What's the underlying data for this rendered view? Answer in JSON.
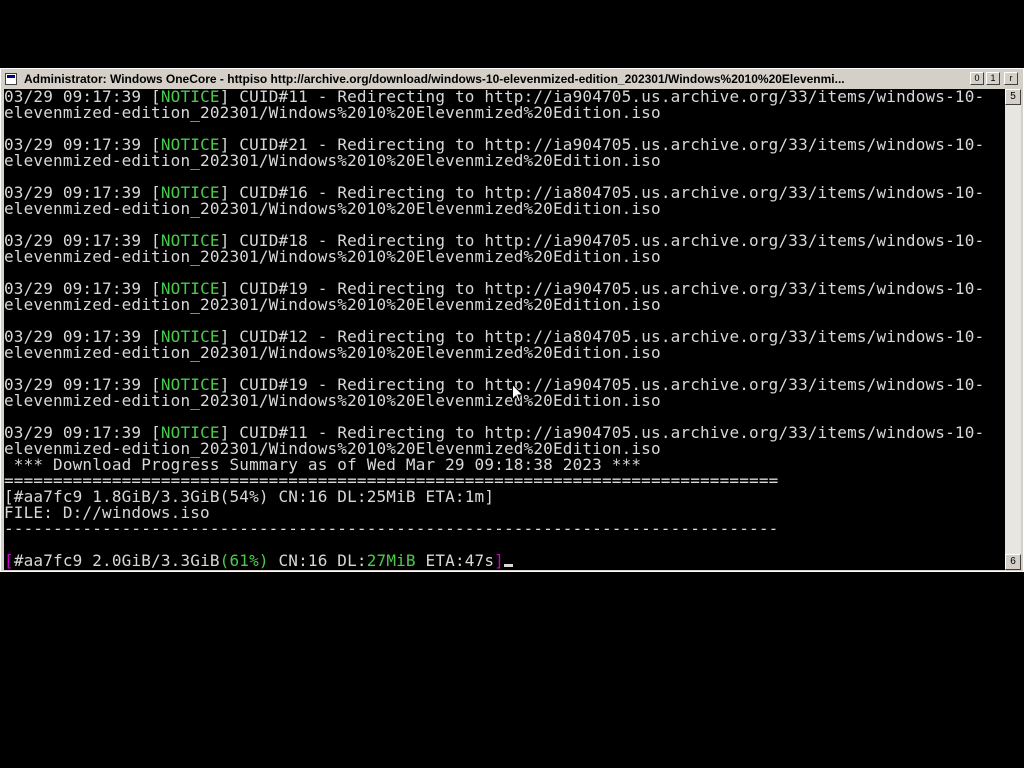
{
  "window": {
    "title": "Administrator:  Windows OneCore - httpiso  http://archive.org/download/windows-10-elevenmized-edition_202301/Windows%2010%20Elevenmi...",
    "minimize_glyph": "0",
    "maximize_glyph": "1",
    "close_glyph": "r"
  },
  "scrollbar": {
    "up_glyph": "5",
    "down_glyph": "6"
  },
  "log_entries": [
    {
      "time": "03/29 09:17:39 ",
      "lb": "[",
      "level": "NOTICE",
      "rb": "]",
      "msg": " CUID#11 - Redirecting to http://ia904705.us.archive.org/33/items/windows-10-",
      "cont": "elevenmized-edition_202301/Windows%2010%20Elevenmized%20Edition.iso"
    },
    {
      "time": "03/29 09:17:39 ",
      "lb": "[",
      "level": "NOTICE",
      "rb": "]",
      "msg": " CUID#21 - Redirecting to http://ia904705.us.archive.org/33/items/windows-10-",
      "cont": "elevenmized-edition_202301/Windows%2010%20Elevenmized%20Edition.iso"
    },
    {
      "time": "03/29 09:17:39 ",
      "lb": "[",
      "level": "NOTICE",
      "rb": "]",
      "msg": " CUID#16 - Redirecting to http://ia804705.us.archive.org/33/items/windows-10-",
      "cont": "elevenmized-edition_202301/Windows%2010%20Elevenmized%20Edition.iso"
    },
    {
      "time": "03/29 09:17:39 ",
      "lb": "[",
      "level": "NOTICE",
      "rb": "]",
      "msg": " CUID#18 - Redirecting to http://ia904705.us.archive.org/33/items/windows-10-",
      "cont": "elevenmized-edition_202301/Windows%2010%20Elevenmized%20Edition.iso"
    },
    {
      "time": "03/29 09:17:39 ",
      "lb": "[",
      "level": "NOTICE",
      "rb": "]",
      "msg": " CUID#19 - Redirecting to http://ia904705.us.archive.org/33/items/windows-10-",
      "cont": "elevenmized-edition_202301/Windows%2010%20Elevenmized%20Edition.iso"
    },
    {
      "time": "03/29 09:17:39 ",
      "lb": "[",
      "level": "NOTICE",
      "rb": "]",
      "msg": " CUID#12 - Redirecting to http://ia804705.us.archive.org/33/items/windows-10-",
      "cont": "elevenmized-edition_202301/Windows%2010%20Elevenmized%20Edition.iso"
    },
    {
      "time": "03/29 09:17:39 ",
      "lb": "[",
      "level": "NOTICE",
      "rb": "]",
      "msg": " CUID#19 - Redirecting to http://ia904705.us.archive.org/33/items/windows-10-",
      "cont": "elevenmized-edition_202301/Windows%2010%20Elevenmized%20Edition.iso"
    },
    {
      "time": "03/29 09:17:39 ",
      "lb": "[",
      "level": "NOTICE",
      "rb": "]",
      "msg": " CUID#11 - Redirecting to http://ia904705.us.archive.org/33/items/windows-10-",
      "cont": "elevenmized-edition_202301/Windows%2010%20Elevenmized%20Edition.iso"
    }
  ],
  "summary": {
    "header": " *** Download Progress Summary as of Wed Mar 29 09:18:38 2023 ***",
    "separator_double": "===============================================================================",
    "progress": "[#aa7fc9 1.8GiB/3.3GiB(54%) CN:16 DL:25MiB ETA:1m]",
    "file": "FILE: D://windows.iso",
    "separator_single": "-------------------------------------------------------------------------------"
  },
  "status": {
    "open_bracket": "[",
    "gid_size": "#aa7fc9 2.0GiB/3.3GiB",
    "percent": "(61%)",
    "cn_dl": " CN:16 DL:",
    "speed": "27MiB",
    "eta": " ETA:47s",
    "close_bracket": "]"
  },
  "colors": {
    "notice": "#4cc94c",
    "bracket_magenta": "#c800c8",
    "text": "#d8d8d8",
    "console_bg": "#000000",
    "chrome": "#d4d0c8"
  },
  "icons": [
    "app-system-icon",
    "minimize-icon",
    "maximize-icon",
    "close-icon",
    "scroll-up-arrow-icon",
    "scroll-down-arrow-icon",
    "mouse-pointer-icon",
    "text-cursor"
  ]
}
